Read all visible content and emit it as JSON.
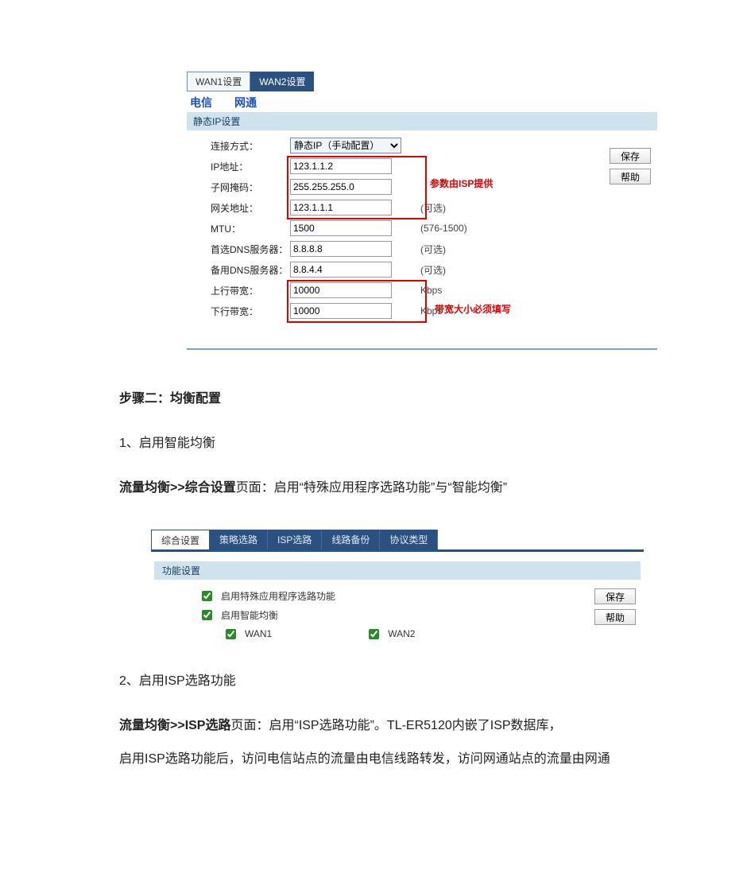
{
  "panel1": {
    "tabs": {
      "wan1": "WAN1设置",
      "wan2": "WAN2设置"
    },
    "isps": {
      "dianxin": "电信",
      "wangtong": "网通"
    },
    "section_title": "静态IP设置",
    "rows": {
      "conn_type_label": "连接方式：",
      "conn_type_value": "静态IP（手动配置）",
      "ip_label": "IP地址：",
      "ip_value": "123.1.1.2",
      "mask_label": "子网掩码：",
      "mask_value": "255.255.255.0",
      "gw_label": "网关地址：",
      "gw_value": "123.1.1.1",
      "gw_suffix": "(可选)",
      "mtu_label": "MTU：",
      "mtu_value": "1500",
      "mtu_suffix": "(576-1500)",
      "dns1_label": "首选DNS服务器：",
      "dns1_value": "8.8.8.8",
      "dns1_suffix": "(可选)",
      "dns2_label": "备用DNS服务器：",
      "dns2_value": "8.8.4.4",
      "dns2_suffix": "(可选)",
      "up_label": "上行带宽：",
      "up_value": "10000",
      "up_unit": "Kbps",
      "down_label": "下行带宽：",
      "down_value": "10000",
      "down_unit": "Kbps"
    },
    "annot_isp": "参数由ISP提供",
    "annot_bw": "带宽大小必须填写",
    "buttons": {
      "save": "保存",
      "help": "帮助"
    }
  },
  "doc": {
    "step_title": "步骤二：均衡配置",
    "s1": "1、启用智能均衡",
    "s1_body_prefix": "流量均衡>>综合设置",
    "s1_body_rest": "页面：启用“特殊应用程序选路功能”与“智能均衡”",
    "s2": "2、启用ISP选路功能",
    "s2_body_prefix": "流量均衡>>ISP选路",
    "s2_body_rest1": "页面：启用“ISP选路功能”。TL-ER5120内嵌了ISP数据库，",
    "s2_body_rest2": "启用ISP选路功能后，访问电信站点的流量由电信线路转发，访问网通站点的流量由网通"
  },
  "panel2": {
    "tabs": {
      "t1": "综合设置",
      "t2": "策略选路",
      "t3": "ISP选路",
      "t4": "线路备份",
      "t5": "协议类型"
    },
    "section_title": "功能设置",
    "opts": {
      "special": "启用特殊应用程序选路功能",
      "smart": "启用智能均衡",
      "wan1": "WAN1",
      "wan2": "WAN2"
    },
    "buttons": {
      "save": "保存",
      "help": "帮助"
    }
  }
}
